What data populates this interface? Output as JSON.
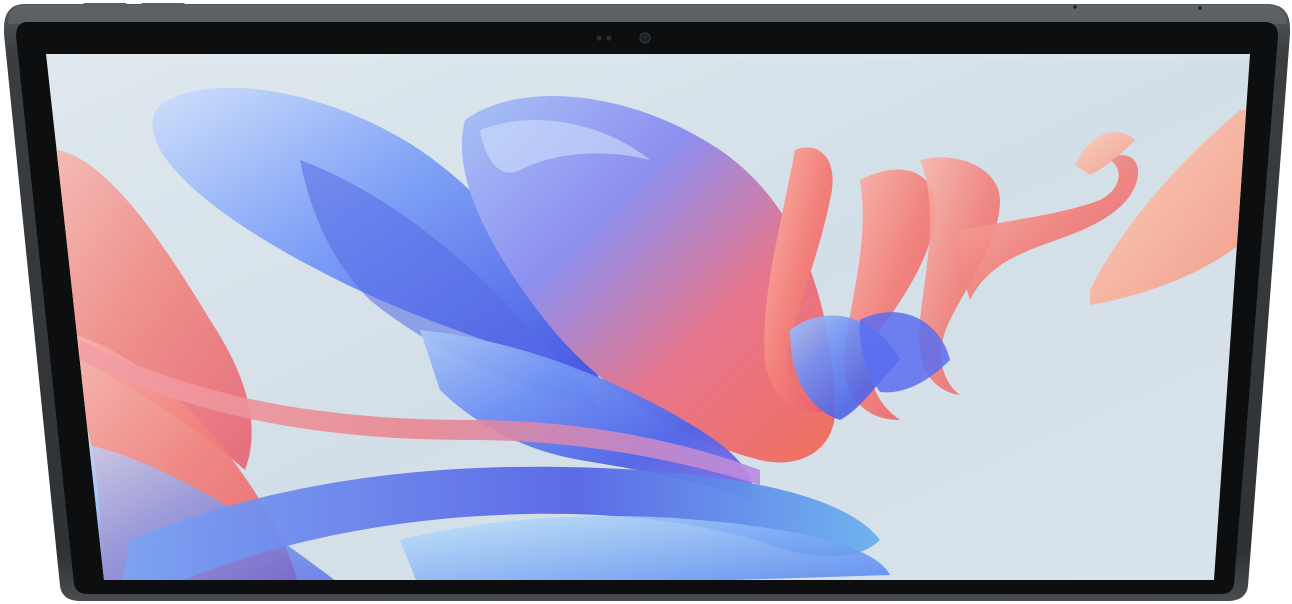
{
  "device": {
    "type": "tablet",
    "orientation": "landscape",
    "frame_color": "#3c3f42",
    "bezel_color": "#0d0e0f",
    "hardware": {
      "buttons": [
        "volume-up-button",
        "volume-down-button"
      ],
      "front_camera": "front-camera",
      "ambient_sensor": "ambient-light-sensor"
    }
  },
  "screen": {
    "content": "wallpaper",
    "wallpaper": {
      "style": "abstract-petals",
      "colors": {
        "background": "#d9e4ec",
        "blue": "#4e6ff0",
        "violet": "#8c74e8",
        "coral": "#f07a6a",
        "pink": "#f59aa6",
        "peach": "#f6b394"
      }
    }
  }
}
